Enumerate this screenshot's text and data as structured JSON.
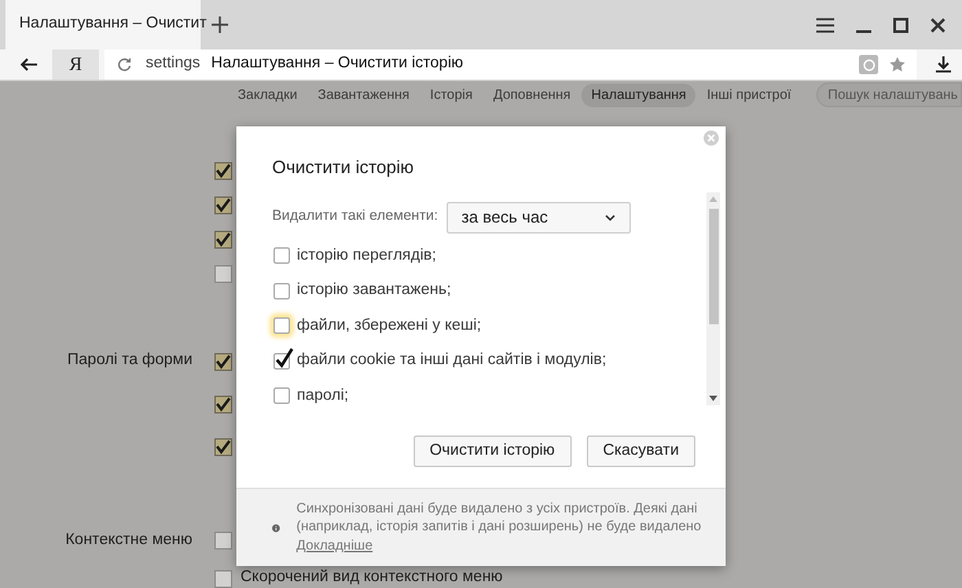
{
  "browser": {
    "tab": {
      "title": "Налаштування – Очистит",
      "selected": true
    },
    "address": {
      "logo_text": "Я",
      "scheme": "settings",
      "title": "Налаштування – Очистити історію"
    }
  },
  "settings_nav": [
    {
      "label": "Закладки",
      "selected": false
    },
    {
      "label": "Завантаження",
      "selected": false
    },
    {
      "label": "Історія",
      "selected": false
    },
    {
      "label": "Доповнення",
      "selected": false
    },
    {
      "label": "Налаштування",
      "selected": true
    },
    {
      "label": "Інші пристрої",
      "selected": false
    }
  ],
  "settings_search": {
    "placeholder": "Пошук налаштувань"
  },
  "sections": [
    {
      "options": [
        {
          "checked": true
        },
        {
          "checked": true
        },
        {
          "checked": true
        },
        {
          "checked": false
        }
      ]
    },
    {
      "title": "Паролі та форми",
      "options": [
        {
          "checked": true
        },
        {
          "checked": true
        },
        {
          "checked": true
        }
      ]
    },
    {
      "title": "Контекстне меню",
      "options": [
        {
          "checked": false
        },
        {
          "checked": false,
          "label": "Скорочений вид контекстного меню"
        }
      ]
    }
  ],
  "dialog": {
    "title": "Очистити історію",
    "period_label": "Видалити такі елементи:",
    "period_value": "за весь час",
    "items": [
      {
        "label": "історію переглядів;",
        "checked": false,
        "focused": false
      },
      {
        "label": "історію завантажень;",
        "checked": false,
        "focused": false
      },
      {
        "label": "файли, збережені у кеші;",
        "checked": false,
        "focused": true
      },
      {
        "label": "файли cookie та інші дані сайтів і модулів;",
        "checked": true,
        "focused": false
      },
      {
        "label": "паролі;",
        "checked": false,
        "focused": false
      }
    ],
    "buttons": [
      {
        "label": "Очистити історію"
      },
      {
        "label": "Скасувати"
      }
    ],
    "notice": {
      "text": "Синхронізовані дані буде видалено з усіх пристроїв. Деякі дані (наприклад, історія запитів і дані розширень) не буде видалено",
      "link": "Докладніше"
    }
  }
}
